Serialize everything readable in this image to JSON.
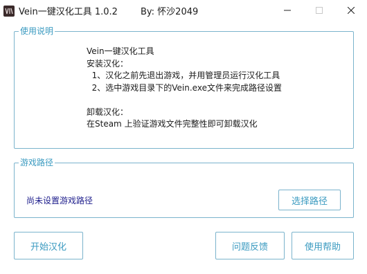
{
  "window": {
    "title": "Vein一键汉化工具 1.0.2",
    "author": "By:  怀沙2049",
    "icon_name": "app-logo-icon",
    "controls": {
      "minimize_icon": "minimize-icon",
      "maximize_icon": "maximize-icon",
      "close_icon": "close-icon"
    }
  },
  "usage": {
    "group_title": "使用说明",
    "lines": [
      "Vein一键汉化工具",
      "安装汉化：",
      "  1、汉化之前先退出游戏，并用管理员运行汉化工具",
      "  2、选中游戏目录下的Vein.exe文件来完成路径设置",
      "",
      "卸载汉化：",
      "在Steam 上验证游戏文件完整性即可卸载汉化"
    ]
  },
  "path": {
    "group_title": "游戏路径",
    "status": "尚未设置游戏路径",
    "select_button": "选择路径"
  },
  "actions": {
    "start_button": "开始汉化",
    "feedback_button": "问题反馈",
    "help_button": "使用帮助"
  },
  "colors": {
    "accent": "#3a9ac0",
    "border": "#7ab3cc",
    "status_text": "#1e1e8c"
  }
}
